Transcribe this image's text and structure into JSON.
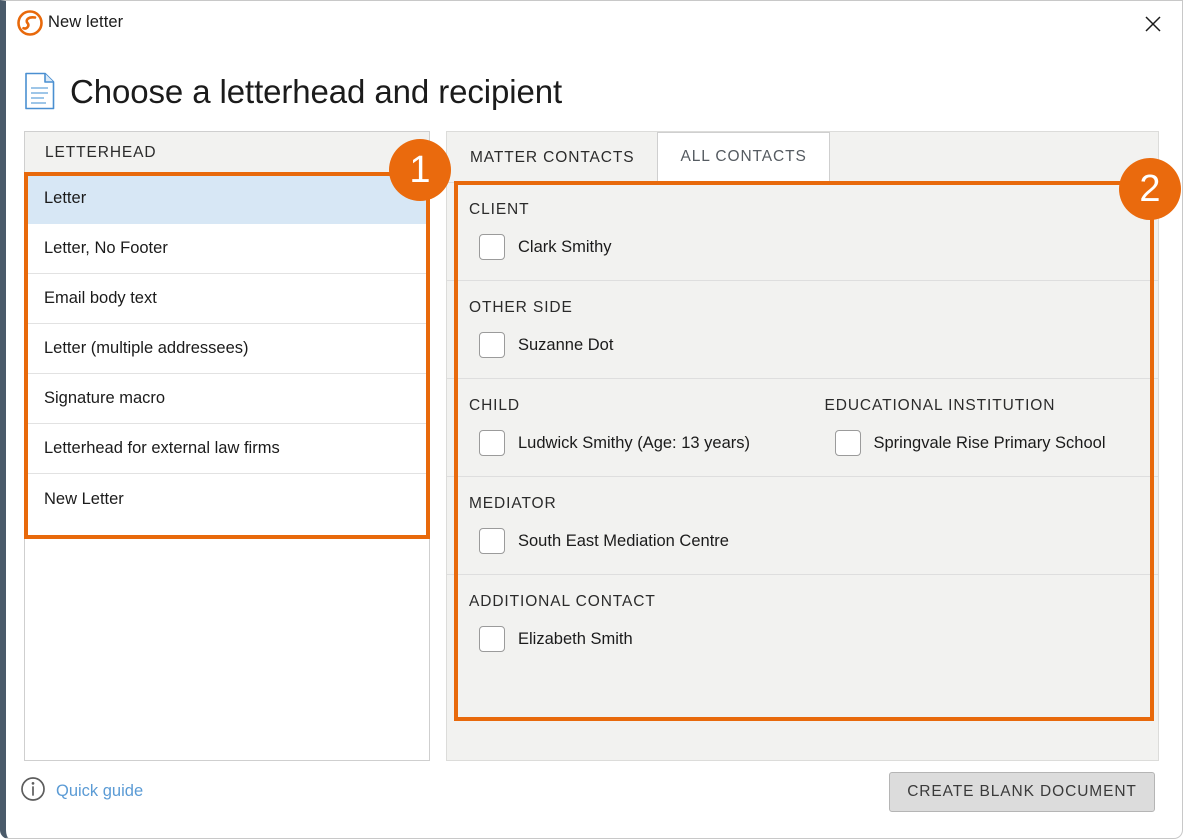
{
  "window": {
    "title": "New letter",
    "logo_icon": "sophie-spiral-logo-icon",
    "close_icon": "close-icon"
  },
  "heading": {
    "icon": "document-page-icon",
    "title": "Choose a letterhead and recipient"
  },
  "letterhead": {
    "header": "LETTERHEAD",
    "items": [
      {
        "label": "Letter",
        "selected": true
      },
      {
        "label": "Letter, No Footer",
        "selected": false
      },
      {
        "label": "Email body text",
        "selected": false
      },
      {
        "label": "Letter (multiple addressees)",
        "selected": false
      },
      {
        "label": "Signature macro",
        "selected": false
      },
      {
        "label": "Letterhead for external law firms",
        "selected": false
      },
      {
        "label": "New Letter",
        "selected": false
      }
    ]
  },
  "contacts": {
    "tabs": [
      {
        "label": "MATTER CONTACTS",
        "active": true
      },
      {
        "label": "ALL CONTACTS",
        "active": false
      }
    ],
    "groups": [
      {
        "columns": [
          {
            "label": "CLIENT",
            "contacts": [
              {
                "name": "Clark Smithy",
                "checked": false
              }
            ]
          }
        ]
      },
      {
        "columns": [
          {
            "label": "OTHER SIDE",
            "contacts": [
              {
                "name": "Suzanne Dot",
                "checked": false
              }
            ]
          }
        ]
      },
      {
        "columns": [
          {
            "label": "CHILD",
            "contacts": [
              {
                "name": "Ludwick Smithy (Age: 13 years)",
                "checked": false
              }
            ]
          },
          {
            "label": "EDUCATIONAL INSTITUTION",
            "contacts": [
              {
                "name": "Springvale Rise Primary School",
                "checked": false
              }
            ]
          }
        ]
      },
      {
        "columns": [
          {
            "label": "MEDIATOR",
            "contacts": [
              {
                "name": "South East Mediation Centre",
                "checked": false
              }
            ]
          }
        ]
      },
      {
        "columns": [
          {
            "label": "ADDITIONAL CONTACT",
            "contacts": [
              {
                "name": "Elizabeth Smith",
                "checked": false
              }
            ]
          }
        ]
      }
    ]
  },
  "footer": {
    "quick_guide_icon": "info-circle-icon",
    "quick_guide_label": "Quick guide",
    "create_button_label": "CREATE BLANK DOCUMENT"
  },
  "annotations": [
    {
      "number": "1"
    },
    {
      "number": "2"
    }
  ],
  "colors": {
    "accent_orange": "#ea6a0d",
    "selected_row_blue": "#d7e7f5",
    "link_blue": "#5b9bd5",
    "panel_gray": "#f2f2f0",
    "window_border": "#4a5a6a"
  }
}
